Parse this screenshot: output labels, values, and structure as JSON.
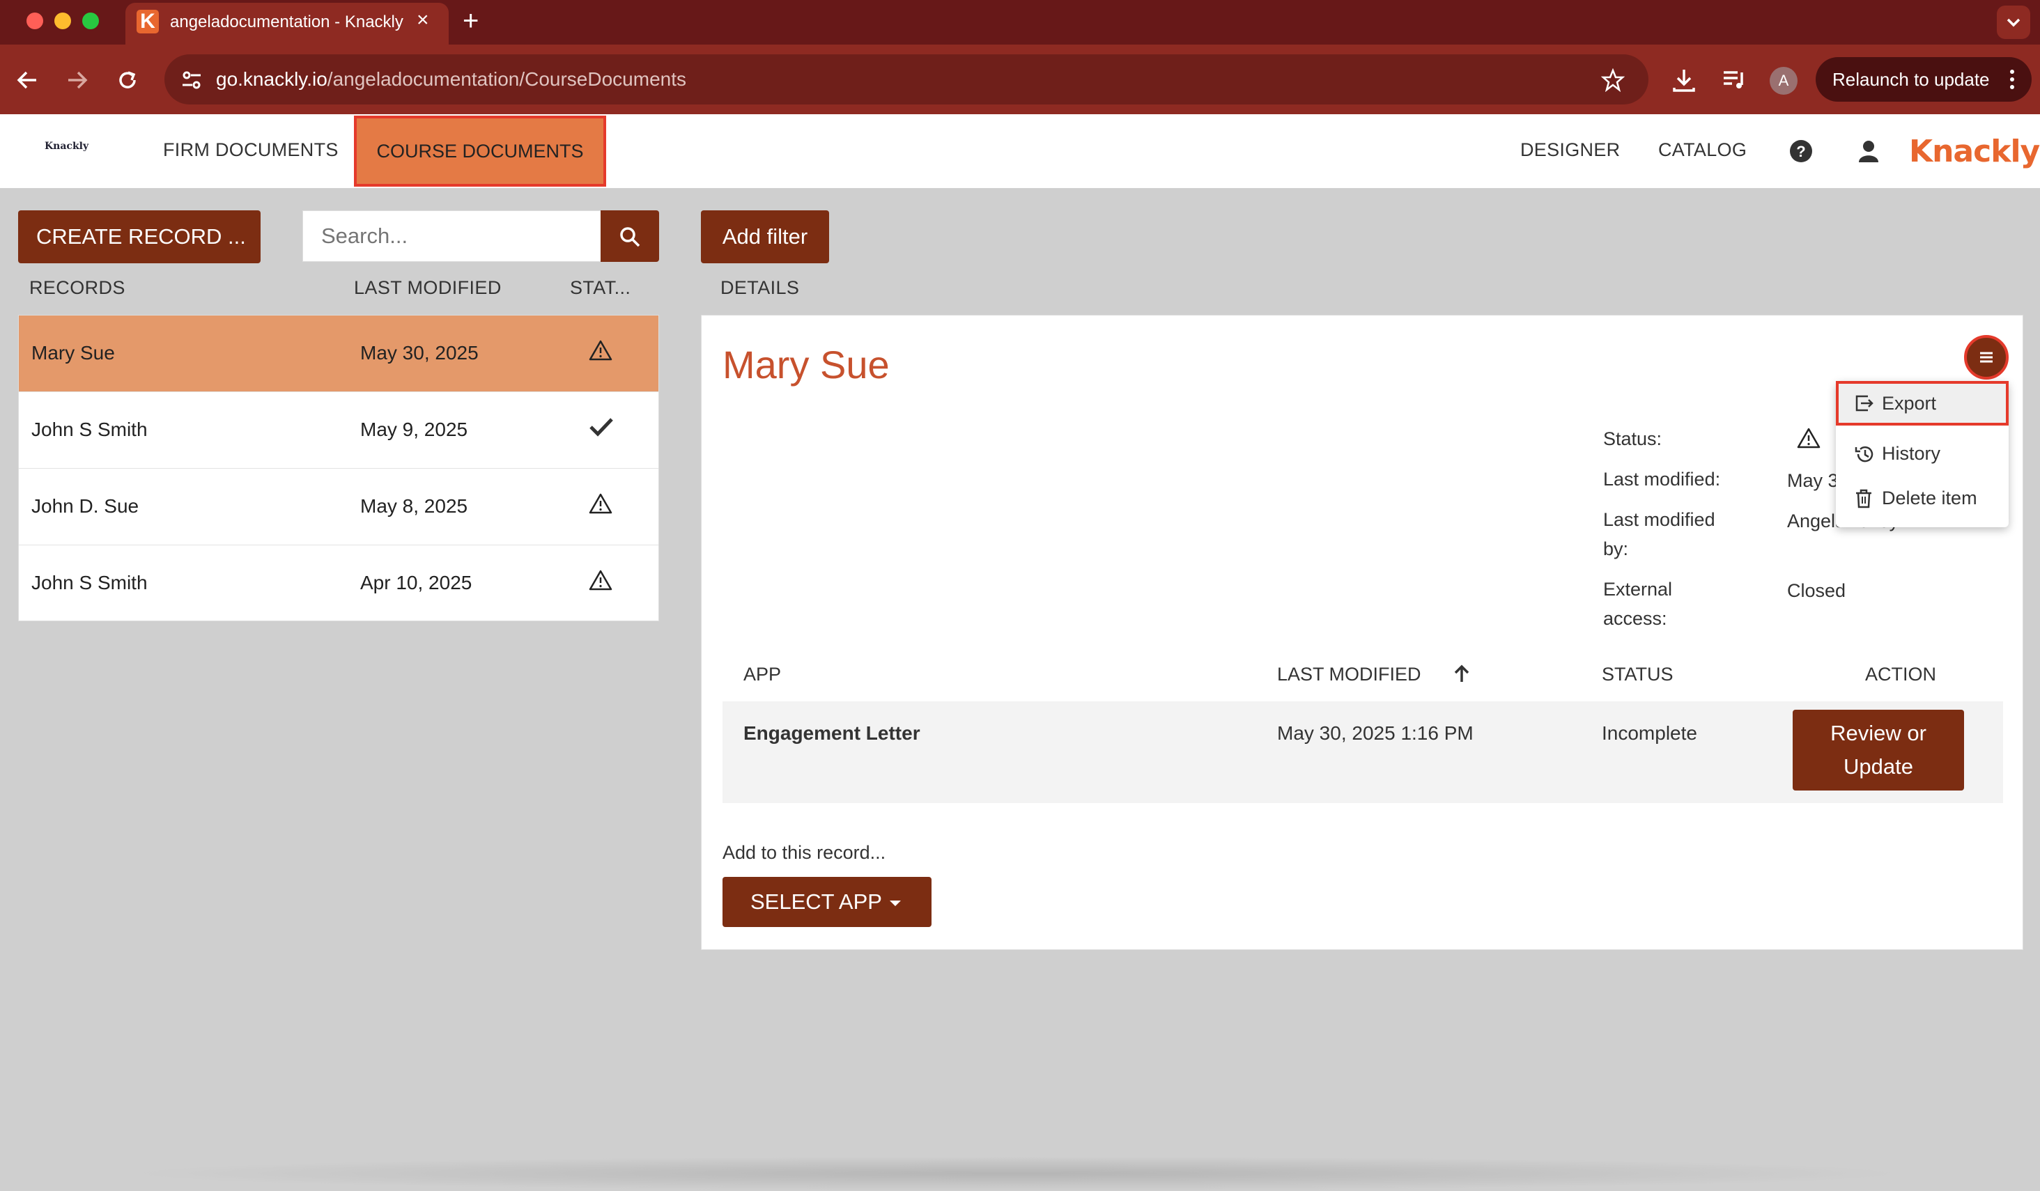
{
  "browser": {
    "tab_title": "angeladocumentation - Knackly",
    "tab_favicon_letter": "K",
    "url_host": "go.knackly.io",
    "url_path": "/angeladocumentation/CourseDocuments",
    "relaunch_label": "Relaunch to update",
    "profile_initial": "A",
    "colors": {
      "frame": "#671818",
      "toolbar": "#8e2a22"
    }
  },
  "header": {
    "small_logo": "Knackly",
    "nav": [
      {
        "label": "FIRM DOCUMENTS",
        "active": false
      },
      {
        "label": "COURSE DOCUMENTS",
        "active": true
      }
    ],
    "right_nav": {
      "designer": "DESIGNER",
      "catalog": "CATALOG"
    },
    "brand": "Knackly",
    "icons": [
      "help-icon",
      "user-icon"
    ]
  },
  "left_panel": {
    "create_label": "CREATE RECORD  ...",
    "search_placeholder": "Search...",
    "columns": {
      "records": "RECORDS",
      "last_modified": "LAST MODIFIED",
      "status": "STAT..."
    },
    "records": [
      {
        "name": "Mary Sue",
        "date": "May 30, 2025",
        "status": "warning",
        "selected": true
      },
      {
        "name": "John S Smith",
        "date": "May 9, 2025",
        "status": "complete",
        "selected": false
      },
      {
        "name": "John D. Sue",
        "date": "May 8, 2025",
        "status": "warning",
        "selected": false
      },
      {
        "name": "John S Smith",
        "date": "Apr 10, 2025",
        "status": "warning",
        "selected": false
      }
    ]
  },
  "details": {
    "add_filter_label": "Add filter",
    "header": "DETAILS",
    "record_title": "Mary Sue",
    "meta": {
      "status_label": "Status:",
      "last_modified_label": "Last modified:",
      "last_modified_value": "May 3",
      "last_modified_by_label_1": "Last modified",
      "last_modified_by_label_2": "by:",
      "last_modified_by_value": "Angela Talley",
      "external_access_label_1": "External",
      "external_access_label_2": "access:",
      "external_access_value": "Closed"
    },
    "menu": [
      {
        "label": "Export",
        "icon": "export-icon"
      },
      {
        "label": "History",
        "icon": "history-icon"
      },
      {
        "label": "Delete item",
        "icon": "trash-icon"
      }
    ],
    "apps_table": {
      "columns": {
        "app": "APP",
        "last_modified": "LAST MODIFIED",
        "status": "STATUS",
        "action": "ACTION"
      },
      "rows": [
        {
          "app": "Engagement Letter",
          "last_modified": "May 30, 2025 1:16 PM",
          "status": "Incomplete",
          "action_line1": "Review or",
          "action_line2": "Update"
        }
      ]
    },
    "add_to_record_label": "Add to this record...",
    "select_app_label": "SELECT APP"
  },
  "colors": {
    "accent": "#7c2d12",
    "selected_row": "#e4996a",
    "active_tab": "#e47a45",
    "title": "#c7512d",
    "highlight_border": "#e53a2b"
  }
}
